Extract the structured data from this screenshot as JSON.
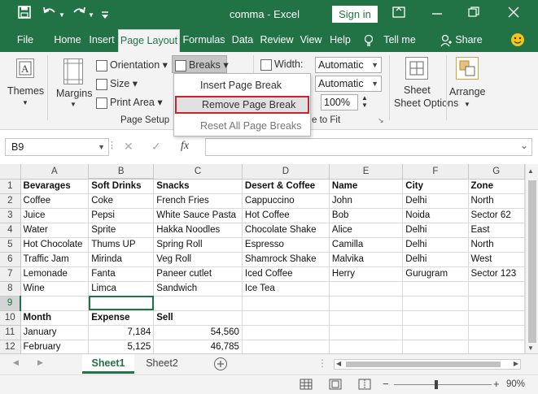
{
  "titlebar": {
    "save_icon": "save-icon",
    "undo_icon": "undo-icon",
    "redo_icon": "redo-icon",
    "title": "comma  -  Excel",
    "signin": "Sign in"
  },
  "tabs": [
    "File",
    "Home",
    "Insert",
    "Page Layout",
    "Formulas",
    "Data",
    "Review",
    "View",
    "Help",
    "Tell me",
    "Share"
  ],
  "ribbon": {
    "themes": "Themes",
    "margins": "Margins",
    "orientation": "Orientation",
    "size": "Size",
    "print_area": "Print Area",
    "breaks": "Breaks",
    "page_setup": "Page Setup",
    "width_label": "Width:",
    "width_value": "Automatic",
    "height_value": "Automatic",
    "scale_value": "100%",
    "scale_group": "e to Fit",
    "sheet_options": "Sheet Options",
    "arrange": "Arrange"
  },
  "breaks_menu": {
    "insert": "Insert Page Break",
    "remove": "Remove Page Break",
    "reset": "Reset All Page Breaks"
  },
  "formula_bar": {
    "name_box": "B9",
    "fx": "fx",
    "value": ""
  },
  "columns": [
    "A",
    "B",
    "C",
    "D",
    "E",
    "F",
    "G"
  ],
  "rows": [
    [
      "1",
      "Bevarages",
      "Soft Drinks",
      "Snacks",
      "Desert & Coffee",
      "Name",
      "City",
      "Zone"
    ],
    [
      "2",
      "Coffee",
      "Coke",
      "French Fries",
      "Cappuccino",
      "John",
      "Delhi",
      "North"
    ],
    [
      "3",
      "Juice",
      "Pepsi",
      "White Sauce Pasta",
      "Hot Coffee",
      "Bob",
      "Noida",
      "Sector 62"
    ],
    [
      "4",
      "Water",
      "Sprite",
      "Hakka Noodles",
      "Chocolate Shake",
      "Alice",
      "Delhi",
      "East"
    ],
    [
      "5",
      "Hot Chocolate",
      "Thums UP",
      "Spring Roll",
      "Espresso",
      "Camilla",
      "Delhi",
      "North"
    ],
    [
      "6",
      "Traffic Jam",
      "Mirinda",
      "Veg Roll",
      "Shamrock Shake",
      "Malvika",
      "Delhi",
      "West"
    ],
    [
      "7",
      "Lemonade",
      "Fanta",
      "Paneer cutlet",
      "Iced Coffee",
      "Herry",
      "Gurugram",
      "Sector 123"
    ],
    [
      "8",
      "Wine",
      "Limca",
      "Sandwich",
      "Ice Tea",
      "",
      "",
      ""
    ],
    [
      "9",
      "",
      "",
      "",
      "",
      "",
      "",
      ""
    ],
    [
      "10",
      "Month",
      "Expense",
      "Sell",
      "",
      "",
      "",
      ""
    ],
    [
      "11",
      "January",
      "7,184",
      "54,560",
      "",
      "",
      "",
      ""
    ],
    [
      "12",
      "February",
      "5,125",
      "46,785",
      "",
      "",
      "",
      ""
    ]
  ],
  "sheets": [
    "Sheet1",
    "Sheet2"
  ],
  "status": {
    "zoom": "90%",
    "minus": "−",
    "plus": "+"
  },
  "colors": {
    "accent": "#217346",
    "highlight_border": "#d0202a"
  }
}
